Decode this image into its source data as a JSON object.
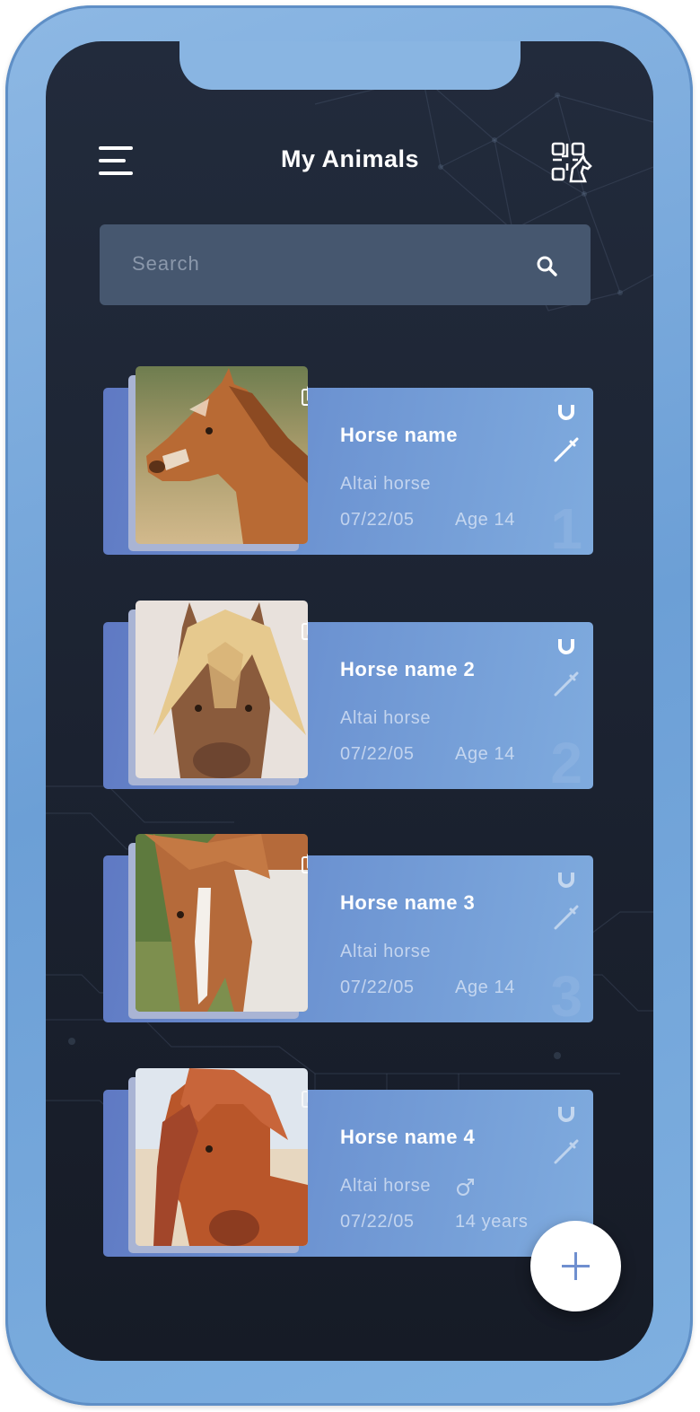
{
  "header": {
    "title": "My Animals",
    "menu_icon": "hamburger-menu-icon",
    "scan_icon": "qr-scan-horse-icon"
  },
  "search": {
    "placeholder": "Search",
    "icon": "search-icon"
  },
  "animals": [
    {
      "name": "Horse name",
      "breed": "Altai horse",
      "date": "07/22/05",
      "age": "Age 14",
      "number": "1"
    },
    {
      "name": "Horse name 2",
      "breed": "Altai horse",
      "date": "07/22/05",
      "age": "Age 14",
      "number": "2"
    },
    {
      "name": "Horse name 3",
      "breed": "Altai horse",
      "date": "07/22/05",
      "age": "Age 14",
      "number": "3"
    },
    {
      "name": "Horse name 4",
      "breed": "Altai horse",
      "date": "07/22/05",
      "age": "14 years",
      "sex_icon": "male-icon"
    }
  ],
  "card_icons": [
    "gallery-icon",
    "horseshoe-icon",
    "syringe-icon"
  ],
  "fab": {
    "icon": "plus-icon"
  },
  "colors": {
    "frame": "#7aaadf",
    "screen_bg": "#1e2635",
    "search_bg": "#46576f",
    "card_start": "#5f79c3",
    "card_end": "#7fabde",
    "text": "#ffffff"
  }
}
